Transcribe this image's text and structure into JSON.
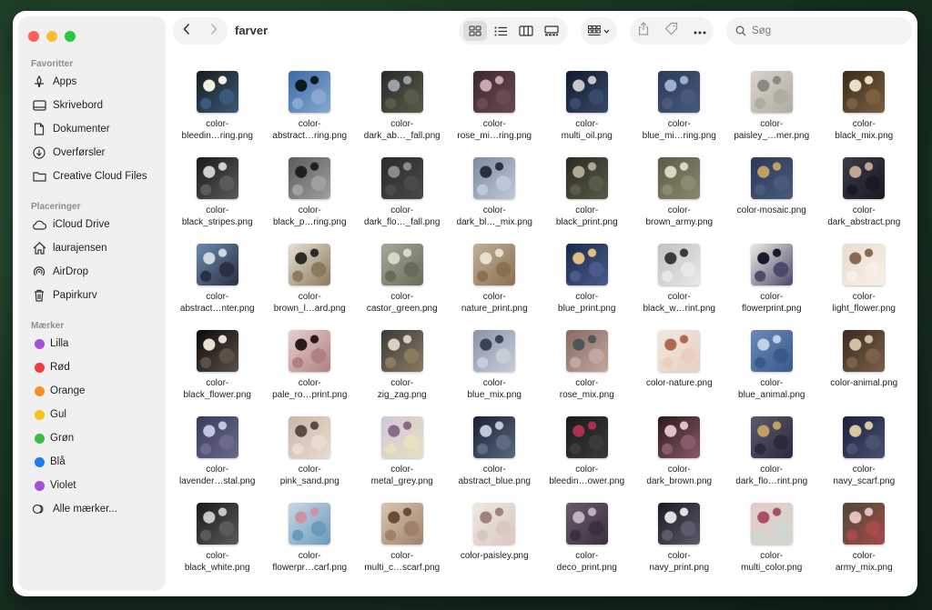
{
  "window": {
    "title": "farver"
  },
  "sidebar": {
    "favorites_title": "Favoritter",
    "favorites": [
      {
        "label": "Apps",
        "icon": "apps-icon"
      },
      {
        "label": "Skrivebord",
        "icon": "desktop-icon"
      },
      {
        "label": "Dokumenter",
        "icon": "document-icon"
      },
      {
        "label": "Overførsler",
        "icon": "download-icon"
      },
      {
        "label": "Creative Cloud Files",
        "icon": "folder-icon"
      }
    ],
    "locations_title": "Placeringer",
    "locations": [
      {
        "label": "iCloud Drive",
        "icon": "cloud-icon"
      },
      {
        "label": "laurajensen",
        "icon": "home-icon"
      },
      {
        "label": "AirDrop",
        "icon": "airdrop-icon"
      },
      {
        "label": "Papirkurv",
        "icon": "trash-icon"
      }
    ],
    "tags_title": "Mærker",
    "tags": [
      {
        "label": "Lilla",
        "color": "#a550d6"
      },
      {
        "label": "Rød",
        "color": "#f23c3c"
      },
      {
        "label": "Orange",
        "color": "#f7901e"
      },
      {
        "label": "Gul",
        "color": "#f6c418"
      },
      {
        "label": "Grøn",
        "color": "#3fba48"
      },
      {
        "label": "Blå",
        "color": "#1e7cf0"
      },
      {
        "label": "Violet",
        "color": "#a550d6"
      }
    ],
    "all_tags": "Alle mærker..."
  },
  "search": {
    "placeholder": "Søg"
  },
  "files": [
    {
      "l1": "color-",
      "l2": "bleedin…ring.png",
      "c": [
        "#1a1a1a",
        "#f2f0e0",
        "#3a5a7a"
      ]
    },
    {
      "l1": "color-",
      "l2": "abstract…ring.png",
      "c": [
        "#3a6aa8",
        "#101820",
        "#88a8d0"
      ]
    },
    {
      "l1": "color-",
      "l2": "dark_ab…_fall.png",
      "c": [
        "#2a2a2a",
        "#9aa0a8",
        "#5a5a4a"
      ]
    },
    {
      "l1": "color-",
      "l2": "rose_mi…ring.png",
      "c": [
        "#3a2a2e",
        "#c8a8b0",
        "#6a4a50"
      ]
    },
    {
      "l1": "color-",
      "l2": "multi_oil.png",
      "c": [
        "#101a2e",
        "#c8c8c8",
        "#3a4a6a"
      ]
    },
    {
      "l1": "color-",
      "l2": "blue_mi…ring.png",
      "c": [
        "#2a3a5a",
        "#9ab0d0",
        "#4a5a7a"
      ]
    },
    {
      "l1": "color-",
      "l2": "paisley_…mer.png",
      "c": [
        "#d8d4cc",
        "#8a8a80",
        "#b0aca0"
      ]
    },
    {
      "l1": "color-",
      "l2": "black_mix.png",
      "c": [
        "#3a2a1a",
        "#e8e0c8",
        "#7a6040"
      ]
    },
    {
      "l1": "color-",
      "l2": "black_stripes.png",
      "c": [
        "#1a1a1a",
        "#d0d0d0",
        "#5a5a5a"
      ]
    },
    {
      "l1": "color-",
      "l2": "black_p…ring.png",
      "c": [
        "#5a5a5a",
        "#202020",
        "#a0a0a0"
      ]
    },
    {
      "l1": "color-",
      "l2": "dark_flo…_fall.png",
      "c": [
        "#2a2a2a",
        "#8a8a8a",
        "#4a4a4a"
      ]
    },
    {
      "l1": "color-",
      "l2": "dark_bl…_mix.png",
      "c": [
        "#7a8aa0",
        "#2a3040",
        "#c0c8d8"
      ]
    },
    {
      "l1": "color-",
      "l2": "black_print.png",
      "c": [
        "#2a2a22",
        "#b0a890",
        "#5a5a48"
      ]
    },
    {
      "l1": "color-",
      "l2": "brown_army.png",
      "c": [
        "#5a5a48",
        "#d8d8c0",
        "#8a8a70"
      ]
    },
    {
      "l1": "",
      "l2": "color-mosaic.png",
      "c": [
        "#2a3a5a",
        "#c0a060",
        "#4a5a7a"
      ]
    },
    {
      "l1": "color-",
      "l2": "dark_abstract.png",
      "c": [
        "#3a3a4a",
        "#c0a890",
        "#1a1a22"
      ]
    },
    {
      "l1": "color-",
      "l2": "abstract…nter.png",
      "c": [
        "#6a8ab0",
        "#d0d8e0",
        "#2a3040"
      ]
    },
    {
      "l1": "color-",
      "l2": "brown_l…ard.png",
      "c": [
        "#e8e0d0",
        "#2a2a2a",
        "#8a7a60"
      ]
    },
    {
      "l1": "color-",
      "l2": "castor_green.png",
      "c": [
        "#a8a898",
        "#d8d8c8",
        "#6a6a58"
      ]
    },
    {
      "l1": "color-",
      "l2": "nature_print.png",
      "c": [
        "#c0b098",
        "#e8e0d0",
        "#8a7050"
      ]
    },
    {
      "l1": "color-",
      "l2": "blue_print.png",
      "c": [
        "#1a2a4a",
        "#e0c080",
        "#4a5a8a"
      ]
    },
    {
      "l1": "color-",
      "l2": "black_w…rint.png",
      "c": [
        "#c0c0c0",
        "#3a3a3a",
        "#e8e8e8"
      ]
    },
    {
      "l1": "color-",
      "l2": "flowerprint.png",
      "c": [
        "#f0ece4",
        "#1a1a2e",
        "#4a4a6a"
      ]
    },
    {
      "l1": "color-",
      "l2": "light_flower.png",
      "c": [
        "#e8dcd0",
        "#8a6a50",
        "#f8f0e8"
      ]
    },
    {
      "l1": "color-",
      "l2": "black_flower.png",
      "c": [
        "#0a0a0a",
        "#e8e0d0",
        "#5a5048"
      ]
    },
    {
      "l1": "color-",
      "l2": "pale_ro…print.png",
      "c": [
        "#e8d0d0",
        "#2a1a1a",
        "#b08080"
      ]
    },
    {
      "l1": "color-",
      "l2": "zig_zag.png",
      "c": [
        "#3a3a3a",
        "#d8d0c0",
        "#8a7a60"
      ]
    },
    {
      "l1": "color-",
      "l2": "blue_mix.png",
      "c": [
        "#8a94a8",
        "#3a4458",
        "#c8ccd8"
      ]
    },
    {
      "l1": "color-",
      "l2": "rose_mix.png",
      "c": [
        "#8a6a60",
        "#4a5a58",
        "#c0a8a0"
      ]
    },
    {
      "l1": "",
      "l2": "color-nature.png",
      "c": [
        "#f0e8e0",
        "#b06a50",
        "#e8d0c0"
      ]
    },
    {
      "l1": "color-",
      "l2": "blue_animal.png",
      "c": [
        "#6a88b8",
        "#c0d0e8",
        "#3a5a8a"
      ]
    },
    {
      "l1": "",
      "l2": "color-animal.png",
      "c": [
        "#3a2a22",
        "#d0c0a0",
        "#7a6048"
      ]
    },
    {
      "l1": "color-",
      "l2": "lavender…stal.png",
      "c": [
        "#3a3a5a",
        "#c0c8e0",
        "#6a6a8a"
      ]
    },
    {
      "l1": "color-",
      "l2": "pink_sand.png",
      "c": [
        "#c8b8a8",
        "#5a4a40",
        "#e8dcd0"
      ]
    },
    {
      "l1": "color-",
      "l2": "metal_grey.png",
      "c": [
        "#d0c8d8",
        "#8a6a8a",
        "#e8e0c0"
      ]
    },
    {
      "l1": "color-",
      "l2": "abstract_blue.png",
      "c": [
        "#1a2030",
        "#c0c8d8",
        "#5a6a80"
      ]
    },
    {
      "l1": "color-",
      "l2": "bleedin…ower.png",
      "c": [
        "#1a1a1a",
        "#a83050",
        "#3a3a3a"
      ]
    },
    {
      "l1": "color-",
      "l2": "dark_brown.png",
      "c": [
        "#2a1a18",
        "#e0c0c8",
        "#8a5a6a"
      ]
    },
    {
      "l1": "color-",
      "l2": "dark_flo…rint.png",
      "c": [
        "#5a5a6a",
        "#c0a060",
        "#2a2a3a"
      ]
    },
    {
      "l1": "color-",
      "l2": "navy_scarf.png",
      "c": [
        "#1a2040",
        "#d8c8a0",
        "#4a5070"
      ]
    },
    {
      "l1": "color-",
      "l2": "black_white.png",
      "c": [
        "#1a1a1a",
        "#c8c8c8",
        "#5a5a5a"
      ]
    },
    {
      "l1": "color-",
      "l2": "flowerpr…carf.png",
      "c": [
        "#c8d8e8",
        "#d090a0",
        "#6a9ab8"
      ]
    },
    {
      "l1": "color-",
      "l2": "multi_c…scarf.png",
      "c": [
        "#d8c8b0",
        "#6a4a38",
        "#a08068"
      ]
    },
    {
      "l1": "",
      "l2": "color-paisley.png",
      "c": [
        "#f0e8e0",
        "#a08080",
        "#d8c8c0"
      ]
    },
    {
      "l1": "color-",
      "l2": "deco_print.png",
      "c": [
        "#6a5a6a",
        "#c0b0c0",
        "#3a3040"
      ]
    },
    {
      "l1": "color-",
      "l2": "navy_print.png",
      "c": [
        "#1a1a22",
        "#e0e0e0",
        "#5a5a6a"
      ]
    },
    {
      "l1": "color-",
      "l2": "multi_color.png",
      "c": [
        "#e8c8c8",
        "#a85068",
        "#d0d8d0"
      ]
    },
    {
      "l1": "color-",
      "l2": "army_mix.png",
      "c": [
        "#4a4a38",
        "#e0c0c0",
        "#a84a4a"
      ]
    }
  ]
}
